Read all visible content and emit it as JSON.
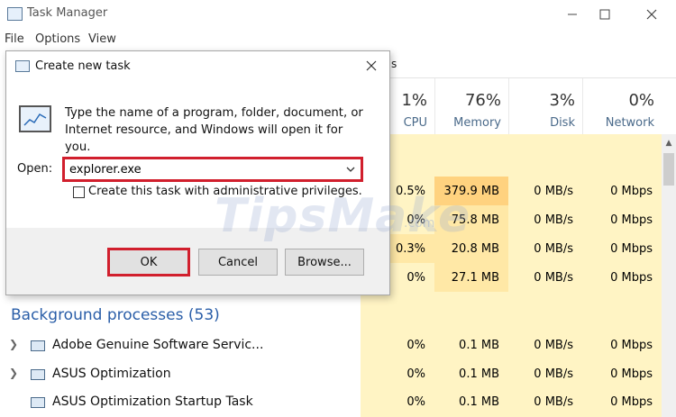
{
  "window": {
    "title": "Task Manager",
    "menu": [
      "File",
      "Options",
      "View"
    ],
    "tab_fragment": "s"
  },
  "columns": [
    {
      "pct": "1%",
      "label": "CPU"
    },
    {
      "pct": "76%",
      "label": "Memory"
    },
    {
      "pct": "3%",
      "label": "Disk"
    },
    {
      "pct": "0%",
      "label": "Network"
    }
  ],
  "top_rows": [
    {
      "cpu": "0.5%",
      "memory": "379.9 MB",
      "disk": "0 MB/s",
      "network": "0 Mbps"
    },
    {
      "cpu": "0%",
      "memory": "75.8 MB",
      "disk": "0 MB/s",
      "network": "0 Mbps"
    },
    {
      "cpu": "0.3%",
      "memory": "20.8 MB",
      "disk": "0 MB/s",
      "network": "0 Mbps"
    },
    {
      "cpu": "0%",
      "memory": "27.1 MB",
      "disk": "0 MB/s",
      "network": "0 Mbps"
    }
  ],
  "background": {
    "label": "Background processes (53)",
    "rows": [
      {
        "name": "Adobe Genuine Software Servic...",
        "cpu": "0%",
        "memory": "0.1 MB",
        "disk": "0 MB/s",
        "network": "0 Mbps"
      },
      {
        "name": "ASUS Optimization",
        "cpu": "0%",
        "memory": "0.1 MB",
        "disk": "0 MB/s",
        "network": "0 Mbps"
      },
      {
        "name": "ASUS Optimization Startup Task",
        "cpu": "0%",
        "memory": "0.1 MB",
        "disk": "0 MB/s",
        "network": "0 Mbps"
      }
    ]
  },
  "dialog": {
    "title": "Create new task",
    "description": "Type the name of a program, folder, document, or Internet resource, and Windows will open it for you.",
    "open_label": "Open:",
    "open_value": "explorer.exe",
    "admin_checkbox_label": "Create this task with administrative privileges.",
    "admin_checked": false,
    "ok_label": "OK",
    "cancel_label": "Cancel",
    "browse_label": "Browse..."
  },
  "watermark": {
    "text": "TipsMake",
    "suffix": ".com"
  },
  "colors": {
    "accent_red": "#d11f2d",
    "link_blue": "#2a5ea8",
    "heat_light": "#fff4c4",
    "heat_medium": "#ffe8a6",
    "heat_strong": "#ffd27f"
  }
}
